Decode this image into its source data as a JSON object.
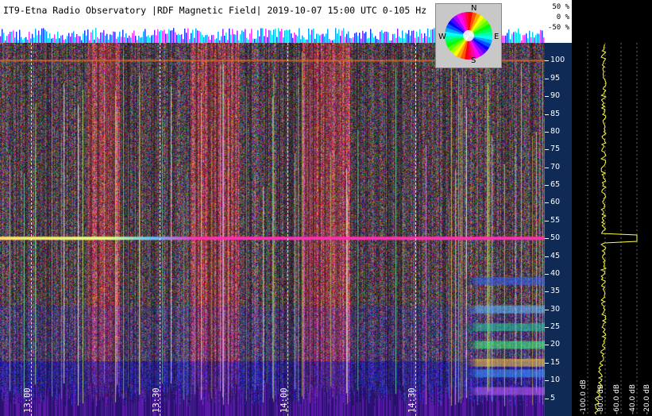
{
  "title": "IT9-Etna Radio Observatory |RDF Magnetic Field| 2019-10-07 15:00 UTC 0-105 Hz",
  "percent_scale": [
    "50 %",
    "0 %",
    "-50 %"
  ],
  "compass": {
    "n": "N",
    "e": "E",
    "s": "S",
    "w": "W"
  },
  "time_labels": [
    "13:00",
    "13:30",
    "14:00",
    "14:30"
  ],
  "frequency_labels": [
    "100",
    "95",
    "90",
    "85",
    "80",
    "75",
    "70",
    "65",
    "60",
    "55",
    "50",
    "45",
    "40",
    "35",
    "30",
    "25",
    "20",
    "15",
    "10",
    "5"
  ],
  "db_labels": [
    "-100.0 dB",
    "-80.0 dB",
    "-60.0 dB",
    "-40.0 dB",
    "-20.0 dB"
  ],
  "colors": {
    "header_bg": "#ffffff",
    "axis_bg": "#0e2a55",
    "line_50hz": "#ff2aa0",
    "avg_trace": "#ffff40"
  }
}
